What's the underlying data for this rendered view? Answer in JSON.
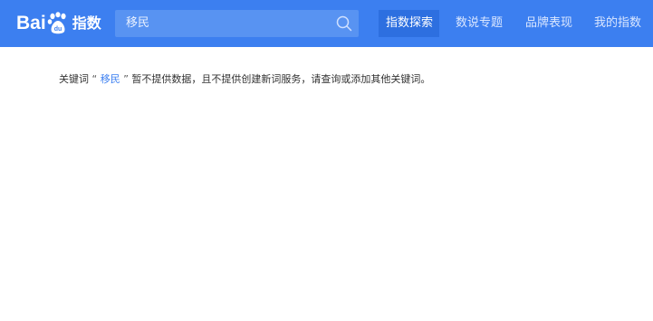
{
  "brand": {
    "logo_text_left": "Bai",
    "logo_paw_text": "du",
    "logo_text_right": "指数",
    "primary_color": "#3c7ff0"
  },
  "search": {
    "value": "移民",
    "icon": "search-icon"
  },
  "nav": {
    "items": [
      {
        "label": "指数探索",
        "active": true
      },
      {
        "label": "数说专题",
        "active": false
      },
      {
        "label": "品牌表现",
        "active": false
      },
      {
        "label": "我的指数",
        "active": false
      }
    ]
  },
  "message": {
    "prefix": "关键词",
    "open_quote": "“",
    "keyword": "移民",
    "close_quote": "”",
    "suffix": "暂不提供数据，且不提供创建新词服务，请查询或添加其他关键词。"
  }
}
